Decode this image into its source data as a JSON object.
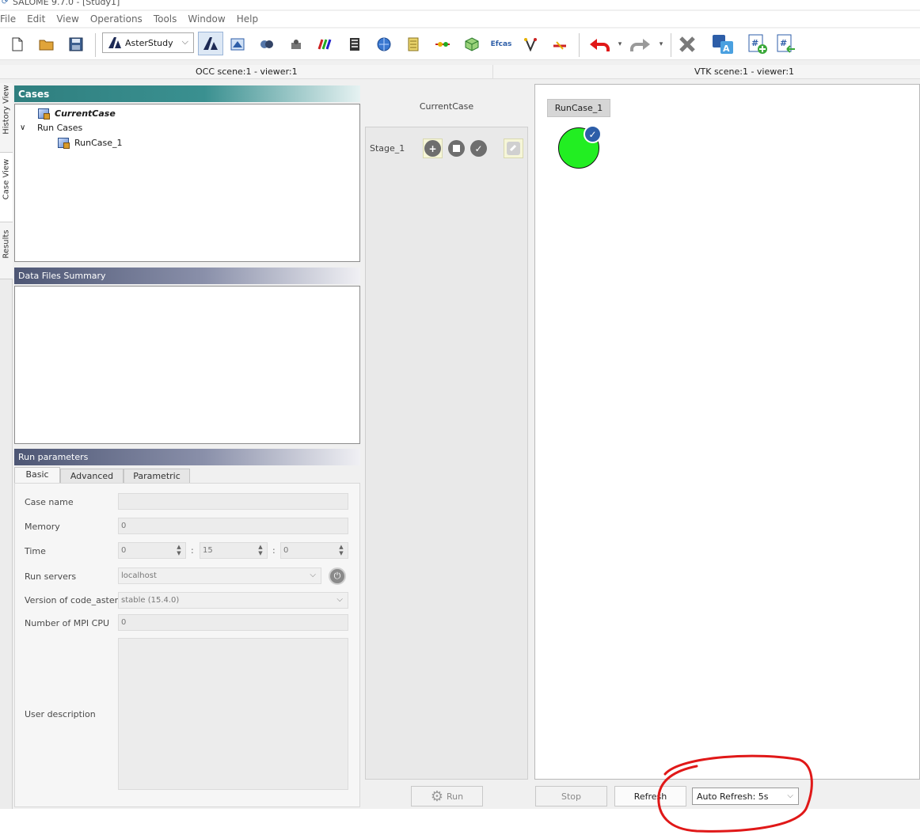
{
  "window": {
    "title": "SALOME 9.7.0 - [Study1]"
  },
  "menu": [
    "File",
    "Edit",
    "View",
    "Operations",
    "Tools",
    "Window",
    "Help"
  ],
  "toolbar": {
    "module_name": "AsterStudy",
    "icons": [
      "new-file-icon",
      "open-folder-icon",
      "save-icon",
      "asterstudy-module-icon",
      "geometry-icon",
      "smesh-icon",
      "paravis-icon",
      "rainbow-icon",
      "matrix-icon",
      "globe-icon",
      "notes-icon",
      "pipeline-icon",
      "cube-icon",
      "efcas-icon",
      "branch-icon",
      "tool-icon",
      "undo-icon",
      "redo-icon",
      "delete-icon",
      "translate-icon",
      "add-parameter-icon",
      "link-parameter-icon"
    ],
    "efcas_label": "Efcas"
  },
  "viewers": {
    "left": "OCC scene:1 - viewer:1",
    "right": "VTK scene:1 - viewer:1"
  },
  "side_tabs": [
    "History View",
    "Case View",
    "Results"
  ],
  "cases": {
    "title": "Cases",
    "current_case": "CurrentCase",
    "run_cases_label": "Run Cases",
    "run_case_1": "RunCase_1"
  },
  "files": {
    "title": "Data Files Summary"
  },
  "params": {
    "title": "Run parameters",
    "tabs": [
      "Basic",
      "Advanced",
      "Parametric"
    ],
    "case_name_label": "Case name",
    "case_name_value": "",
    "memory_label": "Memory",
    "memory_value": "0",
    "time_label": "Time",
    "time_hours": "0",
    "time_minutes": "15",
    "time_seconds": "0",
    "time_sep": ":",
    "servers_label": "Run servers",
    "servers_value": "localhost",
    "version_label": "Version of code_aster",
    "version_value": "stable (15.4.0)",
    "mpi_label": "Number of MPI CPU",
    "mpi_value": "0",
    "description_label": "User description"
  },
  "dashboard": {
    "current_case_title": "CurrentCase",
    "stage_label": "Stage_1",
    "run_case_tag": "RunCase_1",
    "status": "success",
    "status_color": "#22ee22"
  },
  "buttons": {
    "run": "Run",
    "stop": "Stop",
    "refresh": "Refresh",
    "auto_refresh": "Auto Refresh: 5s"
  },
  "colors": {
    "annotation": "#e01818",
    "cases_header": "#2f7f7f",
    "panel_header": "#4d5674"
  }
}
